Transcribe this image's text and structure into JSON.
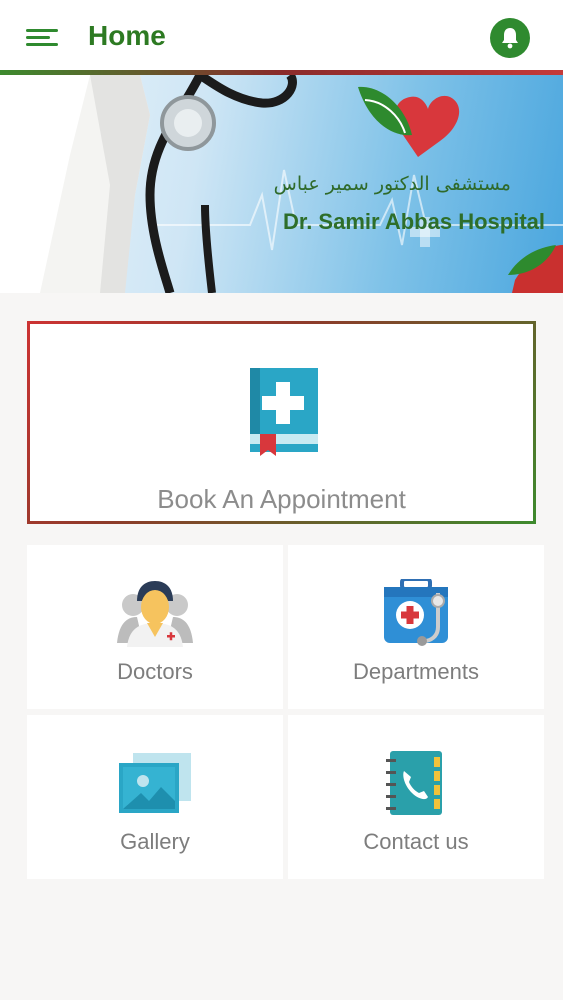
{
  "header": {
    "title": "Home",
    "menu_icon": "hamburger-menu-icon",
    "notification_icon": "bell-icon",
    "accent": "#2f8a2f"
  },
  "banner": {
    "arabic_name": "مستشفى الدكتور سمير عباس",
    "english_name": "Dr. Samir Abbas Hospital"
  },
  "appointment": {
    "label": "Book An Appointment",
    "icon": "medical-book-icon"
  },
  "tiles": [
    {
      "label": "Doctors",
      "icon": "doctor-icon"
    },
    {
      "label": "Departments",
      "icon": "medical-kit-icon"
    },
    {
      "label": "Gallery",
      "icon": "gallery-icon"
    },
    {
      "label": "Contact us",
      "icon": "phone-book-icon"
    }
  ]
}
